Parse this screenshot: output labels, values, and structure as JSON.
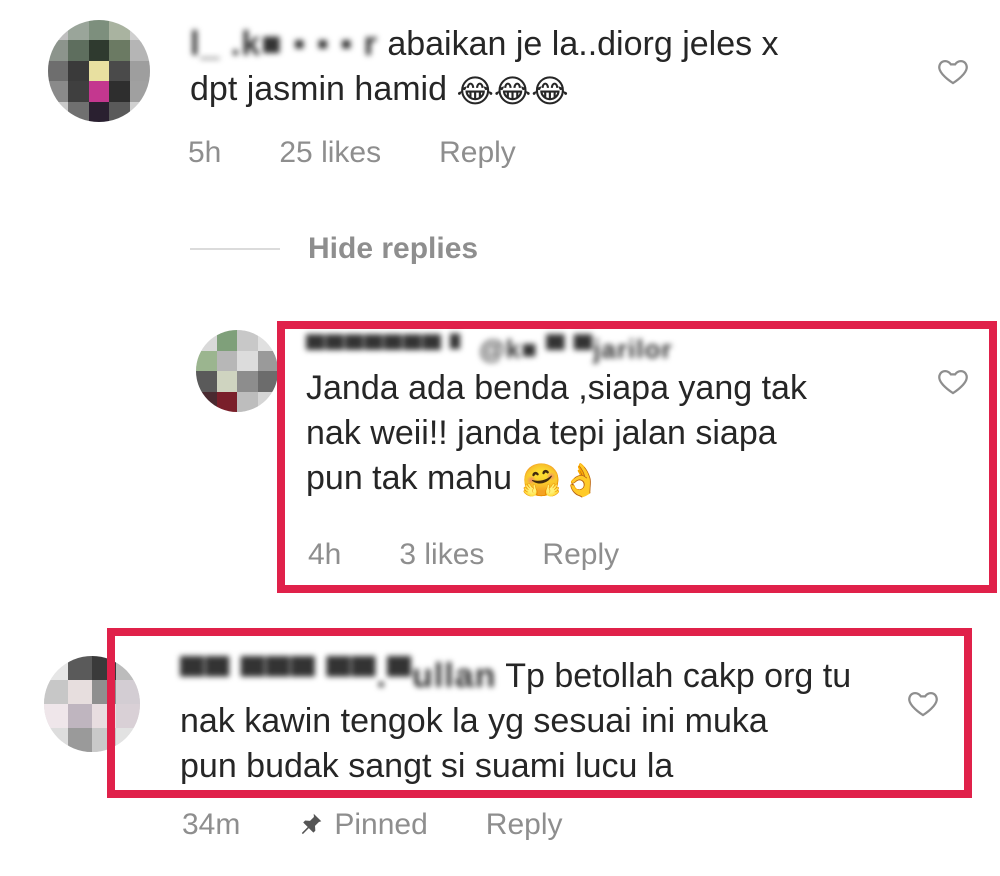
{
  "comments": [
    {
      "username": "l_ .k■ ▪ ▪ ▪ r",
      "text_line1": "abaikan je la..diorg jeles x",
      "text_line2": "dpt jasmin hamid",
      "emoji": "😂😂😂",
      "time": "5h",
      "likes": "25 likes",
      "reply": "Reply"
    },
    {
      "username": "▀▀▀▀▀▀▀ ▘ @k■ ▀ ▀jarilor",
      "text_line1": "Janda ada benda ,siapa yang tak",
      "text_line2": "nak weii!! janda tepi jalan siapa",
      "text_line3": "pun tak mahu",
      "emoji": "🤗👌",
      "time": "4h",
      "likes": "3 likes",
      "reply": "Reply"
    },
    {
      "username": "▀▀ ▀▀▀ ▀▀.▀ullan",
      "text_line1": "Tp betollah cakp org tu",
      "text_line2": "nak kawin tengok la yg sesuai ini muka",
      "text_line3": "pun budak sangt si suami lucu la",
      "time": "34m",
      "pinned": "Pinned",
      "reply": "Reply"
    }
  ],
  "hide_replies": "Hide replies",
  "icons": {
    "heart": "heart-outline-icon",
    "pin": "pin-icon"
  },
  "colors": {
    "highlight": "#e0214a",
    "text": "#262626",
    "meta": "#8e8e8e"
  }
}
